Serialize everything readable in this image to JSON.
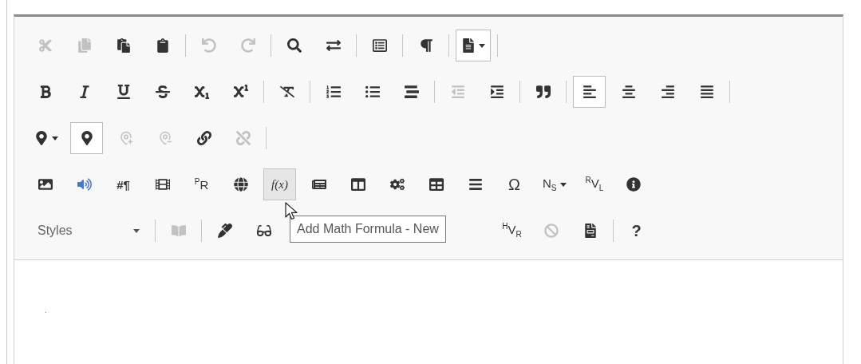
{
  "toolbar": {
    "rows": [
      {
        "groups": [
          [
            {
              "kind": "icon",
              "disabled": true,
              "on": false,
              "hovered": false
            },
            {
              "kind": "icon",
              "disabled": true,
              "on": false,
              "hovered": false
            },
            {
              "kind": "icon",
              "disabled": false,
              "on": false,
              "hovered": false
            },
            {
              "kind": "icon",
              "disabled": false,
              "on": false,
              "hovered": false
            }
          ],
          [
            {
              "kind": "icon",
              "disabled": true,
              "on": false,
              "hovered": false
            },
            {
              "kind": "icon",
              "disabled": true,
              "on": false,
              "hovered": false
            }
          ],
          [
            {
              "kind": "icon",
              "disabled": false,
              "on": false,
              "hovered": false
            },
            {
              "kind": "icon",
              "disabled": false,
              "on": false,
              "hovered": false
            }
          ],
          [
            {
              "kind": "icon",
              "disabled": false,
              "on": false,
              "hovered": false
            }
          ],
          [
            {
              "kind": "icon",
              "disabled": false,
              "on": false,
              "hovered": false
            }
          ],
          [
            {
              "kind": "icon-menu",
              "disabled": false,
              "on": true,
              "hovered": false
            }
          ]
        ],
        "end_separator": true
      },
      {
        "groups": [
          [
            {
              "kind": "icon",
              "disabled": false,
              "on": false,
              "hovered": false
            },
            {
              "kind": "icon",
              "disabled": false,
              "on": false,
              "hovered": false
            },
            {
              "kind": "icon",
              "disabled": false,
              "on": false,
              "hovered": false
            },
            {
              "kind": "icon",
              "disabled": false,
              "on": false,
              "hovered": false
            },
            {
              "kind": "icon",
              "disabled": false,
              "on": false,
              "hovered": false
            },
            {
              "kind": "icon",
              "disabled": false,
              "on": false,
              "hovered": false
            }
          ],
          [
            {
              "kind": "icon",
              "disabled": false,
              "on": false,
              "hovered": false
            }
          ],
          [
            {
              "kind": "icon",
              "disabled": false,
              "on": false,
              "hovered": false
            },
            {
              "kind": "icon",
              "disabled": false,
              "on": false,
              "hovered": false
            },
            {
              "kind": "icon",
              "disabled": false,
              "on": false,
              "hovered": false
            }
          ],
          [
            {
              "kind": "icon",
              "disabled": true,
              "on": false,
              "hovered": false
            },
            {
              "kind": "icon",
              "disabled": false,
              "on": false,
              "hovered": false
            }
          ],
          [
            {
              "kind": "icon",
              "disabled": false,
              "on": false,
              "hovered": false
            }
          ],
          [
            {
              "kind": "icon",
              "disabled": false,
              "on": true,
              "hovered": false
            },
            {
              "kind": "icon",
              "disabled": false,
              "on": false,
              "hovered": false
            },
            {
              "kind": "icon",
              "disabled": false,
              "on": false,
              "hovered": false
            },
            {
              "kind": "icon",
              "disabled": false,
              "on": false,
              "hovered": false
            }
          ]
        ],
        "end_separator": true
      },
      {
        "groups": [
          [
            {
              "kind": "icon-menu",
              "disabled": false,
              "on": false,
              "hovered": false
            },
            {
              "kind": "icon",
              "disabled": false,
              "on": true,
              "hovered": false
            },
            {
              "kind": "icon",
              "disabled": true,
              "on": false,
              "hovered": false
            },
            {
              "kind": "icon",
              "disabled": true,
              "on": false,
              "hovered": false
            },
            {
              "kind": "icon",
              "disabled": false,
              "on": false,
              "hovered": false
            },
            {
              "kind": "icon",
              "disabled": true,
              "on": false,
              "hovered": false
            }
          ]
        ],
        "end_separator": true
      },
      {
        "groups": [
          [
            {
              "kind": "icon",
              "disabled": false,
              "on": false,
              "hovered": false
            },
            {
              "kind": "icon",
              "disabled": false,
              "on": false,
              "hovered": false
            },
            {
              "kind": "glyph",
              "text": "#¶",
              "disabled": false,
              "on": false,
              "hovered": false
            },
            {
              "kind": "icon",
              "disabled": false,
              "on": false,
              "hovered": false
            },
            {
              "kind": "glyph",
              "text": "$^{P}$R",
              "disabled": false,
              "on": false,
              "hovered": false
            },
            {
              "kind": "icon",
              "disabled": false,
              "on": false,
              "hovered": false
            },
            {
              "kind": "glyph",
              "text": "f(x)",
              "disabled": false,
              "on": false,
              "hovered": true
            },
            {
              "kind": "icon",
              "disabled": false,
              "on": false,
              "hovered": false
            },
            {
              "kind": "icon",
              "disabled": false,
              "on": false,
              "hovered": false
            },
            {
              "kind": "icon",
              "disabled": false,
              "on": false,
              "hovered": false
            },
            {
              "kind": "icon",
              "disabled": false,
              "on": false,
              "hovered": false
            },
            {
              "kind": "icon",
              "disabled": false,
              "on": false,
              "hovered": false
            },
            {
              "kind": "glyph",
              "text": "Ω",
              "disabled": false,
              "on": false,
              "hovered": false
            },
            {
              "kind": "glyph-menu",
              "text": "N$_{S}$",
              "disabled": false,
              "on": false,
              "hovered": false
            },
            {
              "kind": "glyph",
              "text": "$^{R}$V$_{L}$",
              "disabled": false,
              "on": false,
              "hovered": false
            },
            {
              "kind": "icon",
              "disabled": false,
              "on": false,
              "hovered": false
            }
          ]
        ],
        "end_separator": false
      },
      {
        "groups": [
          [
            {
              "kind": "combo",
              "label": "Styles"
            }
          ],
          [
            {
              "kind": "icon",
              "disabled": true,
              "on": false,
              "hovered": false
            }
          ],
          [
            {
              "kind": "icon",
              "disabled": false,
              "on": false,
              "hovered": false
            },
            {
              "kind": "icon",
              "disabled": false,
              "on": false,
              "hovered": false
            },
            {
              "kind": "glyph",
              "text": "$^{H}$V$_{R}$",
              "disabled": false,
              "on": false,
              "hovered": false
            },
            {
              "kind": "icon",
              "disabled": true,
              "on": false,
              "hovered": false
            },
            {
              "kind": "icon",
              "disabled": false,
              "on": false,
              "hovered": false
            }
          ],
          [
            {
              "kind": "glyph",
              "text": "?",
              "disabled": false,
              "on": false,
              "hovered": false
            }
          ]
        ],
        "end_separator": false
      }
    ]
  },
  "tooltip": {
    "text": "Add Math Formula - New"
  },
  "editor": {
    "text": "."
  }
}
